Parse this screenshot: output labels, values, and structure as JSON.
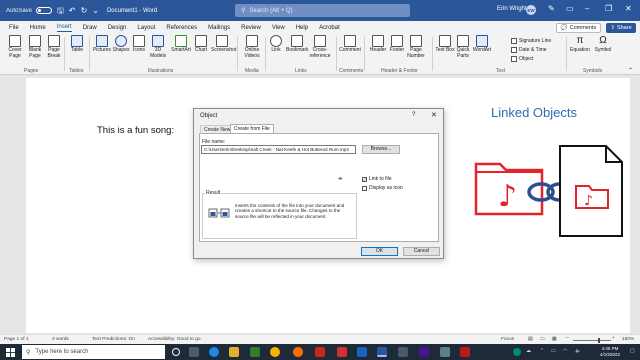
{
  "titlebar": {
    "autosave_label": "AutoSave",
    "autosave_state": "Off",
    "document_title": "Document1 - Word",
    "search_placeholder": "Search (Alt + Q)",
    "user_name": "Erin Wright",
    "user_initials": "EW"
  },
  "tabs": [
    "File",
    "Home",
    "Insert",
    "Draw",
    "Design",
    "Layout",
    "References",
    "Mailings",
    "Review",
    "View",
    "Help",
    "Acrobat"
  ],
  "active_tab": "Insert",
  "comments_label": "Comments",
  "share_label": "Share",
  "ribbon": {
    "buttons": {
      "cover_page": "Cover Page",
      "blank_page": "Blank Page",
      "page_break": "Page Break",
      "table": "Table",
      "pictures": "Pictures",
      "shapes": "Shapes",
      "icons": "Icons",
      "models_3d": "3D Models",
      "smartart": "SmartArt",
      "chart": "Chart",
      "screenshot": "Screenshot",
      "online_videos": "Online Videos",
      "link": "Link",
      "bookmark": "Bookmark",
      "cross_reference": "Cross-reference",
      "comment": "Comment",
      "header": "Header",
      "footer": "Footer",
      "page_number": "Page Number",
      "text_box": "Text Box",
      "quick_parts": "Quick Parts",
      "wordart": "WordArt",
      "signature_line": "Signature Line",
      "date_time": "Date & Time",
      "object": "Object",
      "equation": "Equation",
      "symbol": "Symbol"
    },
    "groups": {
      "pages": "Pages",
      "tables": "Tables",
      "illustrations": "Illustrations",
      "media": "Media",
      "links": "Links",
      "comments": "Comments",
      "header_footer": "Header & Footer",
      "text": "Text",
      "symbols": "Symbols"
    }
  },
  "document": {
    "body_text": "This is a fun song:",
    "heading": "Linked Objects"
  },
  "dialog": {
    "title": "Object",
    "help": "?",
    "close": "✕",
    "tabs": [
      "Create New",
      "Create from File"
    ],
    "active_tab": "Create from File",
    "file_name_label": "File name:",
    "file_name_value": "C:\\Users\\erin\\Desktop\\Salt Creek - Nat Keefe & Hot Buttered Rum.mp3",
    "browse_label": "Browse...",
    "link_to_file_label": "Link to file",
    "link_to_file_checked": true,
    "display_as_icon_label": "Display as icon",
    "display_as_icon_checked": false,
    "result_label": "Result",
    "result_text": "Inserts the contents of the file into your document and creates a shortcut to the source file.  Changes to the source file will be reflected in your document.",
    "ok_label": "OK",
    "cancel_label": "Cancel"
  },
  "statusbar": {
    "page": "Page 1 of 1",
    "words": "3 words",
    "text_predictions": "Text Predictions: On",
    "accessibility": "Accessibility: Good to go",
    "focus": "Focus",
    "zoom": "180%"
  },
  "taskbar": {
    "search_placeholder": "Type here to search",
    "time": "4:46 PM",
    "date": "4/10/2022"
  },
  "colors": {
    "word_blue": "#2b579a",
    "linked_heading": "#2e6db3",
    "media_red": "#e3242b",
    "chain_blue": "#2f4f8f"
  }
}
